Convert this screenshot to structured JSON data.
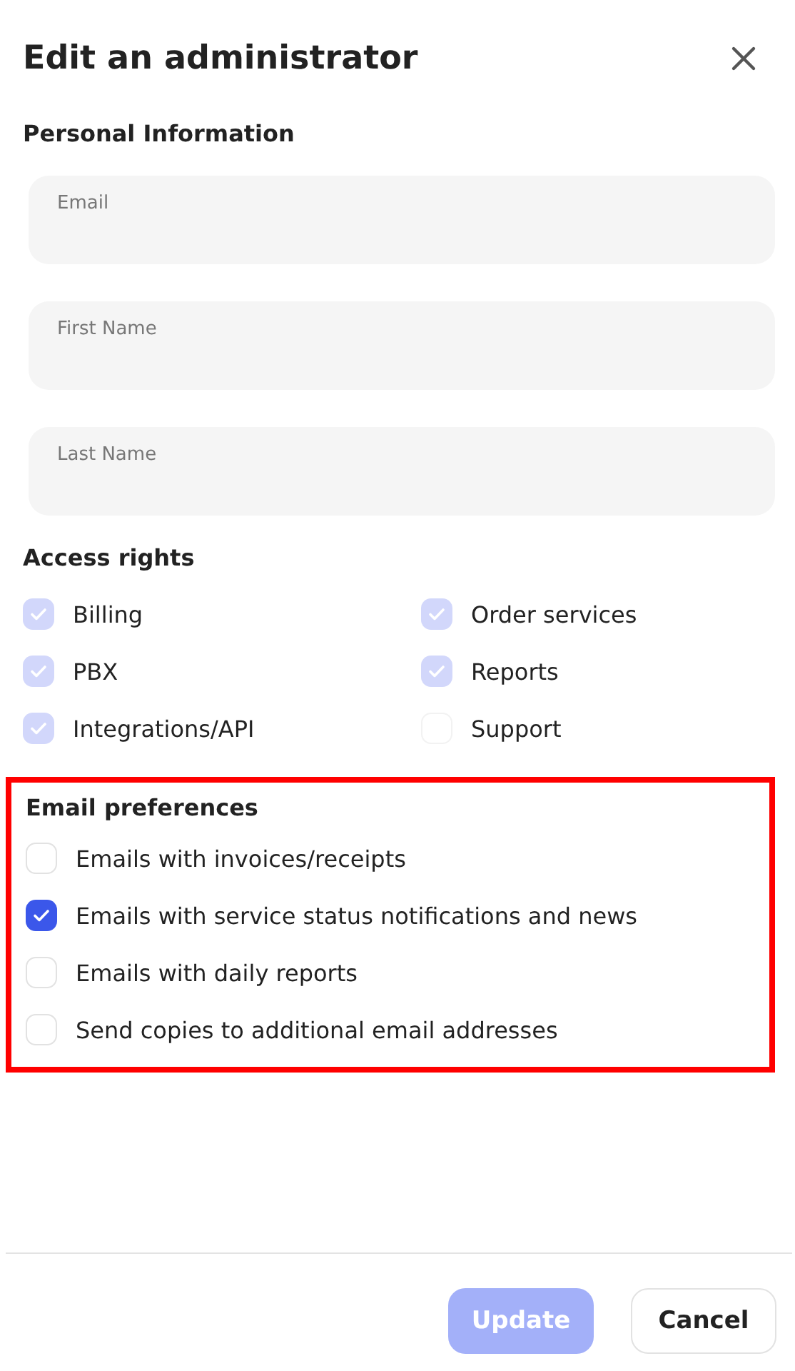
{
  "dialog": {
    "title": "Edit an administrator"
  },
  "personal_information": {
    "heading": "Personal Information",
    "fields": [
      {
        "label": "Email"
      },
      {
        "label": "First Name"
      },
      {
        "label": "Last Name"
      }
    ]
  },
  "access_rights": {
    "heading": "Access rights",
    "disabled": true,
    "items": [
      {
        "label": "Billing",
        "checked": true
      },
      {
        "label": "Order services",
        "checked": true
      },
      {
        "label": "PBX",
        "checked": true
      },
      {
        "label": "Reports",
        "checked": true
      },
      {
        "label": "Integrations/API",
        "checked": true
      },
      {
        "label": "Support",
        "checked": false
      }
    ]
  },
  "email_preferences": {
    "heading": "Email preferences",
    "highlighted": true,
    "items": [
      {
        "label": "Emails with invoices/receipts",
        "checked": false
      },
      {
        "label": "Emails with service status notifications and news",
        "checked": true
      },
      {
        "label": "Emails with daily reports",
        "checked": false
      },
      {
        "label": "Send copies to additional email addresses",
        "checked": false
      }
    ]
  },
  "buttons": [
    {
      "label": "Update",
      "kind": "primary",
      "disabled": true
    },
    {
      "label": "Cancel",
      "kind": "secondary"
    }
  ]
}
